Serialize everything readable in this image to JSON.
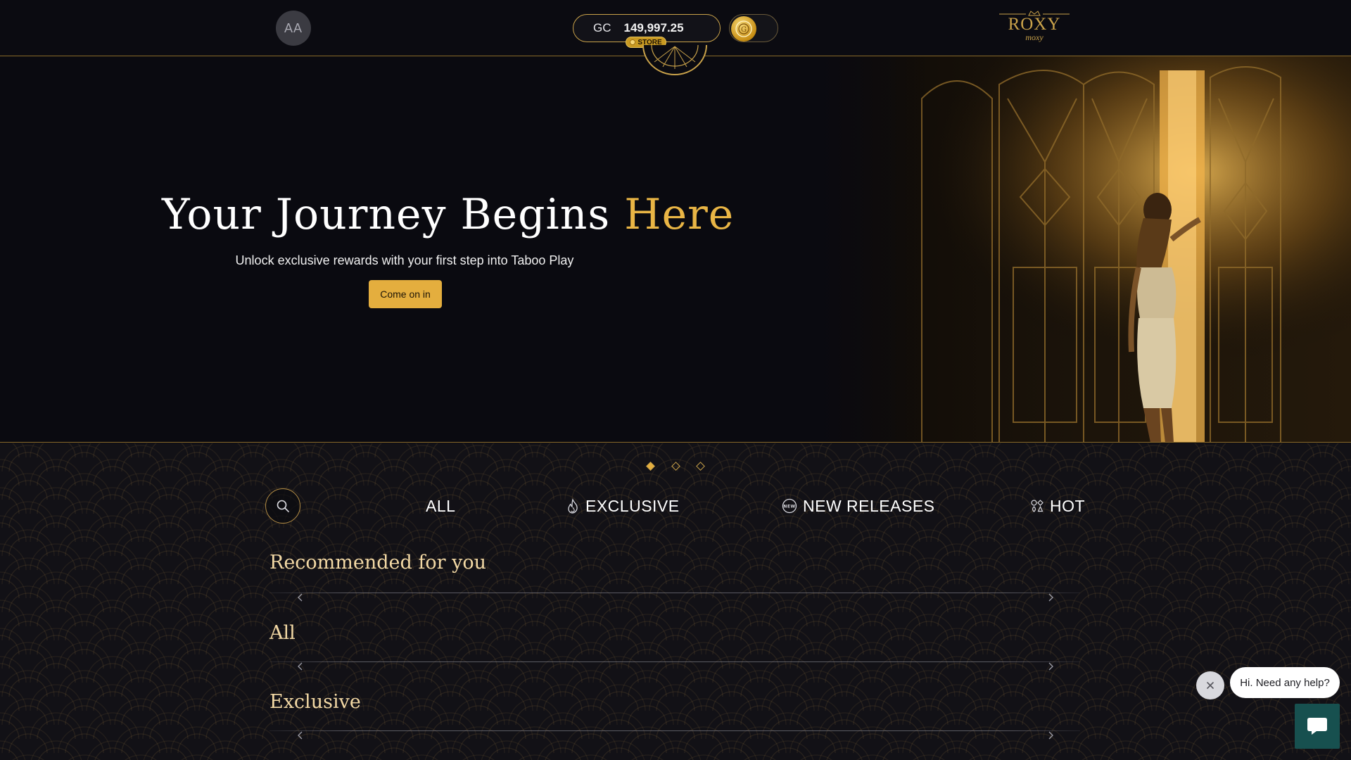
{
  "header": {
    "avatar_initials": "AA",
    "currency": "GC",
    "balance": "149,997.25",
    "store_label": "STORE",
    "logo_brand": "ROXY",
    "logo_sub": "moxy"
  },
  "hero": {
    "title_main": "Your Journey Begins ",
    "title_highlight": "Here",
    "subtitle": "Unlock exclusive rewards with your first step into Taboo Play",
    "cta_label": "Come on in",
    "carousel_dots": 3,
    "active_dot": 0
  },
  "tabs": [
    {
      "label": "ALL",
      "icon": "none"
    },
    {
      "label": "EXCLUSIVE",
      "icon": "flame-icon"
    },
    {
      "label": "NEW RELEASES",
      "icon": "new-badge-icon"
    },
    {
      "label": "HOT",
      "icon": "cards-icon"
    }
  ],
  "sections": [
    {
      "title": "Recommended for you"
    },
    {
      "title": "All"
    },
    {
      "title": "Exclusive"
    }
  ],
  "help": {
    "bubble_text": "Hi. Need any help?"
  },
  "colors": {
    "accent_gold": "#e4ae3e",
    "border_gold": "#c9a24a",
    "background": "#0c0c12",
    "section_title": "#f3d9a5",
    "help_button": "#17504f"
  }
}
